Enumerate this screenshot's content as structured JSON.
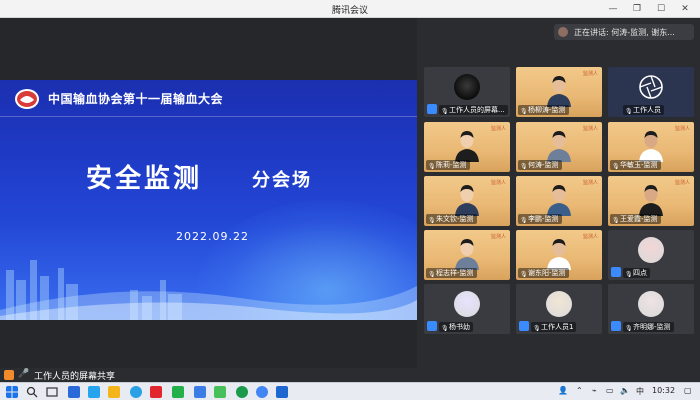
{
  "window": {
    "title": "腾讯会议",
    "min_label": "—",
    "restore_label": "❐",
    "max_label": "☐",
    "close_label": "✕"
  },
  "slide": {
    "organization": "中国输血协会第十一届输血大会",
    "title": "安全监测",
    "subtitle": "分会场",
    "date": "2022.09.22"
  },
  "speaking": {
    "text": "正在讲话: 何涛-监测, 谢东..."
  },
  "share_bar": {
    "text": "工作人员的屏幕共享"
  },
  "participants": [
    {
      "name": "工作人员的屏幕...",
      "kind": "dark-avatar",
      "badge": ""
    },
    {
      "name": "杨柳涛-监测",
      "kind": "video",
      "badge": "监测人"
    },
    {
      "name": "工作人员",
      "kind": "logo",
      "badge": ""
    },
    {
      "name": "陈莉-监测",
      "kind": "video",
      "badge": "监测人"
    },
    {
      "name": "何涛-监测",
      "kind": "video",
      "badge": "监测人"
    },
    {
      "name": "华敏玉-监测",
      "kind": "video",
      "badge": "监测人"
    },
    {
      "name": "朱文钦-监测",
      "kind": "video",
      "badge": "监测人"
    },
    {
      "name": "李鹏-监测",
      "kind": "video",
      "badge": "监测人"
    },
    {
      "name": "王爱霞-监测",
      "kind": "video",
      "badge": "监测人"
    },
    {
      "name": "程志祥-监测",
      "kind": "video",
      "badge": "监测人"
    },
    {
      "name": "谢东阳-监测",
      "kind": "video",
      "badge": "监测人"
    },
    {
      "name": "四点",
      "kind": "avatar",
      "badge": ""
    },
    {
      "name": "杨书幼",
      "kind": "avatar",
      "badge": ""
    },
    {
      "name": "工作人员1",
      "kind": "avatar",
      "badge": ""
    },
    {
      "name": "齐明娜-监测",
      "kind": "avatar",
      "badge": ""
    }
  ],
  "taskbar": {
    "ime": "中",
    "time": "10:32"
  },
  "colors": {
    "slide_blue": "#1f3cc8",
    "video_bg": "#eec182",
    "accent_orange": "#f28b2c",
    "user_blue": "#3a8bff"
  }
}
